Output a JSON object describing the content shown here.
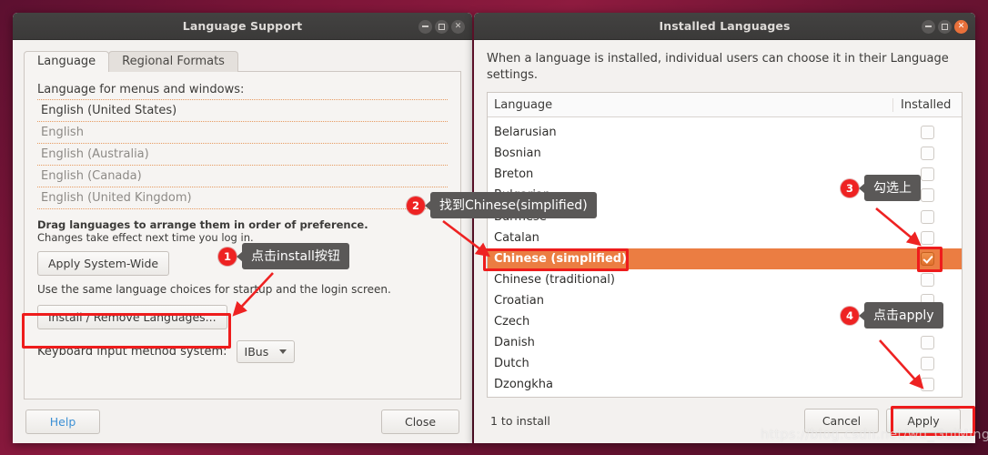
{
  "desktop": {
    "watermark": "https://blog.csdn.net/wu_GuiMing"
  },
  "left_window": {
    "title": "Language Support",
    "controls": {
      "minimize": "minimize-icon",
      "maximize": "maximize-icon",
      "close": "close-icon"
    },
    "tabs": [
      {
        "label": "Language",
        "active": true
      },
      {
        "label": "Regional Formats",
        "active": false
      }
    ],
    "section_label": "Language for menus and windows:",
    "languages": [
      "English (United States)",
      "English",
      "English (Australia)",
      "English (Canada)",
      "English (United Kingdom)"
    ],
    "drag_hint_bold": "Drag languages to arrange them in order of preference.",
    "drag_hint": "Changes take effect next time you log in.",
    "apply_system_wide_label": "Apply System-Wide",
    "system_wide_note": "Use the same language choices for startup and the login screen.",
    "install_remove_label": "Install / Remove Languages...",
    "keyboard_label": "Keyboard input method system:",
    "keyboard_value": "IBus",
    "help_label": "Help",
    "close_label": "Close"
  },
  "right_window": {
    "title": "Installed Languages",
    "controls": {
      "minimize": "minimize-icon",
      "maximize": "maximize-icon",
      "close": "close-icon"
    },
    "description": "When a language is installed, individual users can choose it in their Language settings.",
    "columns": {
      "language": "Language",
      "installed": "Installed"
    },
    "rows": [
      {
        "name": "",
        "checked": false,
        "selected": false,
        "clipped": true
      },
      {
        "name": "Belarusian",
        "checked": false,
        "selected": false
      },
      {
        "name": "Bosnian",
        "checked": false,
        "selected": false
      },
      {
        "name": "Breton",
        "checked": false,
        "selected": false
      },
      {
        "name": "Bulgarian",
        "checked": false,
        "selected": false
      },
      {
        "name": "Burmese",
        "checked": false,
        "selected": false
      },
      {
        "name": "Catalan",
        "checked": false,
        "selected": false
      },
      {
        "name": "Chinese (simplified)",
        "checked": true,
        "selected": true
      },
      {
        "name": "Chinese (traditional)",
        "checked": false,
        "selected": false
      },
      {
        "name": "Croatian",
        "checked": false,
        "selected": false
      },
      {
        "name": "Czech",
        "checked": false,
        "selected": false
      },
      {
        "name": "Danish",
        "checked": false,
        "selected": false
      },
      {
        "name": "Dutch",
        "checked": false,
        "selected": false
      },
      {
        "name": "Dzongkha",
        "checked": false,
        "selected": false
      }
    ],
    "status": "1 to install",
    "cancel_label": "Cancel",
    "apply_label": "Apply"
  },
  "annotations": [
    {
      "number": "1",
      "text": "点击install按钮"
    },
    {
      "number": "2",
      "text": "找到Chinese(simplified)"
    },
    {
      "number": "3",
      "text": "勾选上"
    },
    {
      "number": "4",
      "text": "点击apply"
    }
  ],
  "colors": {
    "selection_orange": "#eb7d42",
    "annotation_red": "#ee1c1c",
    "link_blue": "#3c90d4",
    "titlebar_dark": "#3f3e3d",
    "close_active": "#e8703a"
  }
}
